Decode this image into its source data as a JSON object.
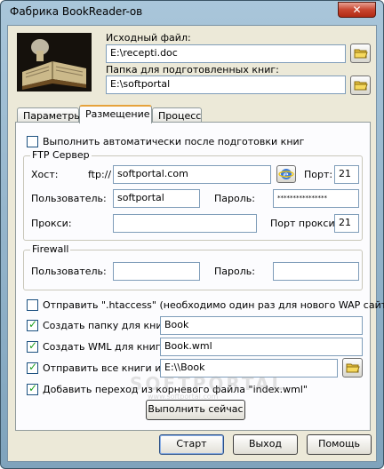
{
  "window": {
    "title": "Фабрика BookReader-ов",
    "close_label": "✕"
  },
  "source": {
    "label": "Исходный файл:",
    "value": "E:\\recepti.doc"
  },
  "output": {
    "label": "Папка для подготовленных книг:",
    "value": "E:\\softportal"
  },
  "tabs": [
    {
      "label": "Параметры",
      "active": false
    },
    {
      "label": "Размещение",
      "active": true
    },
    {
      "label": "Процесс",
      "active": false
    }
  ],
  "auto_run": {
    "label": "Выполнить автоматически после подготовки книг",
    "checked": false
  },
  "ftp": {
    "group_title": "FTP Сервер",
    "host_label": "Хост:",
    "host_prefix": "ftp://",
    "host_value": "softportal.com",
    "port_label": "Порт:",
    "port_value": "21",
    "user_label": "Пользователь:",
    "user_value": "softportal",
    "password_label": "Пароль:",
    "password_value": "****************",
    "proxy_label": "Прокси:",
    "proxy_value": "",
    "proxy_port_label": "Порт прокси:",
    "proxy_port_value": "21"
  },
  "firewall": {
    "group_title": "Firewall",
    "user_label": "Пользователь:",
    "user_value": "",
    "password_label": "Пароль:",
    "password_value": ""
  },
  "options": {
    "htaccess": {
      "label": "Отправить \".htaccess\" (необходимо один раз для нового WAP сайта)",
      "checked": false
    },
    "create_folder": {
      "label": "Создать папку для книг:",
      "checked": true,
      "value": "Book"
    },
    "create_wml": {
      "label": "Создать WML для книг:",
      "checked": true,
      "value": "Book.wml"
    },
    "send_all": {
      "label": "Отправить все книги из:",
      "checked": true,
      "value": "E:\\\\Book"
    },
    "add_link": {
      "label": "Добавить переход из корневого файла \"index.wml\"",
      "checked": true
    }
  },
  "run_now_label": "Выполнить сейчас",
  "buttons": {
    "start": "Старт",
    "exit": "Выход",
    "help": "Помощь"
  },
  "watermark": "SOFTPORTAL",
  "watermark_sub": "www.softportal.com"
}
